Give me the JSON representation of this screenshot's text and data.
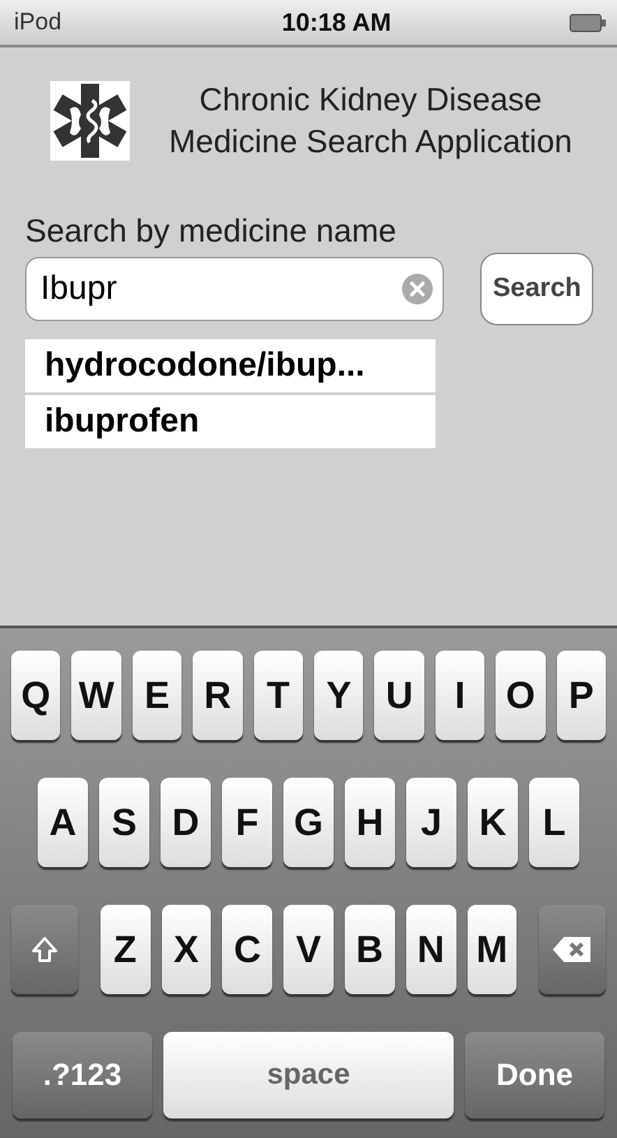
{
  "status_bar": {
    "carrier": "iPod",
    "time": "10:18 AM"
  },
  "header": {
    "title_lines": [
      "Chronic Kidney Disease",
      "Medicine Search Application"
    ]
  },
  "search": {
    "label": "Search by medicine name",
    "value": "Ibupr",
    "button": "Search"
  },
  "suggestions": [
    "hydrocodone/ibup...",
    "ibuprofen"
  ],
  "keyboard": {
    "letter_rows": [
      [
        {
          "kind": "letter",
          "label": "Q"
        },
        {
          "kind": "letter",
          "label": "W"
        },
        {
          "kind": "letter",
          "label": "E"
        },
        {
          "kind": "letter",
          "label": "R"
        },
        {
          "kind": "letter",
          "label": "T"
        },
        {
          "kind": "letter",
          "label": "Y"
        },
        {
          "kind": "letter",
          "label": "U"
        },
        {
          "kind": "letter",
          "label": "I"
        },
        {
          "kind": "letter",
          "label": "O"
        },
        {
          "kind": "letter",
          "label": "P"
        }
      ],
      [
        {
          "kind": "letter",
          "label": "A"
        },
        {
          "kind": "letter",
          "label": "S"
        },
        {
          "kind": "letter",
          "label": "D"
        },
        {
          "kind": "letter",
          "label": "F"
        },
        {
          "kind": "letter",
          "label": "G"
        },
        {
          "kind": "letter",
          "label": "H"
        },
        {
          "kind": "letter",
          "label": "J"
        },
        {
          "kind": "letter",
          "label": "K"
        },
        {
          "kind": "letter",
          "label": "L"
        }
      ],
      [
        {
          "kind": "shift"
        },
        {
          "kind": "letter",
          "label": "Z"
        },
        {
          "kind": "letter",
          "label": "X"
        },
        {
          "kind": "letter",
          "label": "C"
        },
        {
          "kind": "letter",
          "label": "V"
        },
        {
          "kind": "letter",
          "label": "B"
        },
        {
          "kind": "letter",
          "label": "N"
        },
        {
          "kind": "letter",
          "label": "M"
        },
        {
          "kind": "backspace"
        }
      ]
    ],
    "bottom_bar": {
      "numbers_key": ".?123",
      "space_key": "space",
      "done_key": "Done"
    }
  }
}
